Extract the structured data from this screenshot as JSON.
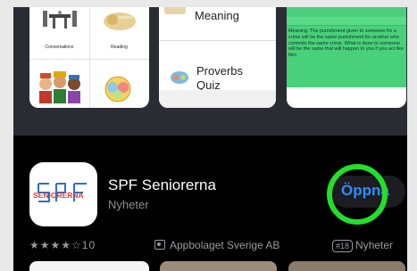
{
  "screenshots": {
    "first": {
      "tiles": [
        {
          "label": "Conversations",
          "icon": "table-chairs-icon"
        },
        {
          "label": "Reading",
          "icon": "scroll-icon"
        },
        {
          "label": "",
          "icon": "people-icon"
        },
        {
          "label": "",
          "icon": "emoji-icon"
        }
      ]
    },
    "second": {
      "item1": "Meaning",
      "item2_line1": "Proverbs",
      "item2_line2": "Quiz"
    },
    "third": {
      "text": "Meaning: The punishment given to someone for a crime will be the same punishment for another who commits the same crime. What is done to someone will be the same that will happen to you if you act like him"
    }
  },
  "app": {
    "name": "SPF Seniorerna",
    "category": "Nyheter",
    "icon_text": "SENIORERNA",
    "icon_letters": "SPF",
    "open_button": "Öppna",
    "rating_count": "10",
    "stars_filled": 4,
    "stars_total": 5,
    "developer": "Appbolaget Sverige AB",
    "rank_badge": "#18",
    "rank_category": "Nyheter"
  },
  "colors": {
    "accent_blue": "#2e8ef5",
    "highlight_ring": "#22e02a",
    "icon_red": "#e23a2c",
    "icon_blue": "#2a6fd1",
    "quiz_green": "#49d07b"
  }
}
